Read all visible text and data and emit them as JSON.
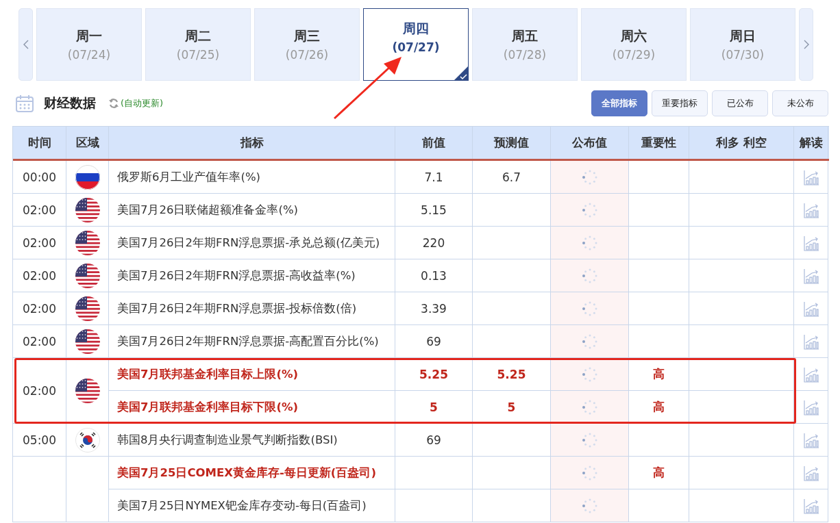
{
  "days": [
    {
      "day": "周一",
      "date": "(07/24)",
      "selected": false
    },
    {
      "day": "周二",
      "date": "(07/25)",
      "selected": false
    },
    {
      "day": "周三",
      "date": "(07/26)",
      "selected": false
    },
    {
      "day": "周四",
      "date": "(07/27)",
      "selected": true
    },
    {
      "day": "周五",
      "date": "(07/28)",
      "selected": false
    },
    {
      "day": "周六",
      "date": "(07/29)",
      "selected": false
    },
    {
      "day": "周日",
      "date": "(07/30)",
      "selected": false
    }
  ],
  "section": {
    "title": "财经数据",
    "auto_update": "(自动更新)"
  },
  "filters": [
    {
      "label": "全部指标",
      "selected": true
    },
    {
      "label": "重要指标",
      "selected": false
    },
    {
      "label": "已公布",
      "selected": false
    },
    {
      "label": "未公布",
      "selected": false
    }
  ],
  "table": {
    "columns": [
      "时间",
      "区域",
      "指标",
      "前值",
      "预测值",
      "公布值",
      "重要性",
      "利多 利空",
      "解读"
    ],
    "groups": [
      {
        "time": "00:00",
        "kind": "ru",
        "highlighted": false,
        "rows": [
          {
            "name": "俄罗斯6月工业产值年率(%)",
            "important": false,
            "prev": "7.1",
            "forecast": "6.7"
          }
        ]
      },
      {
        "time": "02:00",
        "kind": "us",
        "highlighted": false,
        "rows": [
          {
            "name": "美国7月26日联储超额准备金率(%)",
            "important": false,
            "prev": "5.15"
          }
        ]
      },
      {
        "time": "02:00",
        "kind": "us",
        "highlighted": false,
        "rows": [
          {
            "name": "美国7月26日2年期FRN浮息票据-承兑总额(亿美元)",
            "important": false,
            "prev": "220"
          }
        ]
      },
      {
        "time": "02:00",
        "kind": "us",
        "highlighted": false,
        "rows": [
          {
            "name": "美国7月26日2年期FRN浮息票据-高收益率(%)",
            "important": false,
            "prev": "0.13"
          }
        ]
      },
      {
        "time": "02:00",
        "kind": "us",
        "highlighted": false,
        "rows": [
          {
            "name": "美国7月26日2年期FRN浮息票据-投标倍数(倍)",
            "important": false,
            "prev": "3.39"
          }
        ]
      },
      {
        "time": "02:00",
        "kind": "us",
        "highlighted": false,
        "rows": [
          {
            "name": "美国7月26日2年期FRN浮息票据-高配置百分比(%)",
            "important": false,
            "prev": "69"
          }
        ]
      },
      {
        "time": "02:00",
        "kind": "us",
        "highlighted": true,
        "rows": [
          {
            "name": "美国7月联邦基金利率目标上限(%)",
            "important": true,
            "prev": "5.25",
            "forecast": "5.25",
            "importance": "高"
          },
          {
            "name": "美国7月联邦基金利率目标下限(%)",
            "important": true,
            "prev": "5",
            "forecast": "5",
            "importance": "高"
          }
        ]
      },
      {
        "time": "05:00",
        "kind": "kr",
        "highlighted": false,
        "rows": [
          {
            "name": "韩国8月央行调查制造业景气判断指数(BSI)",
            "important": false,
            "prev": "69"
          }
        ]
      },
      {
        "highlighted": false,
        "rows": [
          {
            "name": "美国7月25日COMEX黄金库存-每日更新(百盎司)",
            "important": true,
            "importance": "高"
          },
          {
            "name": "美国7月25日NYMEX钯金库存变动-每日(百盎司)",
            "important": false
          }
        ]
      }
    ]
  }
}
